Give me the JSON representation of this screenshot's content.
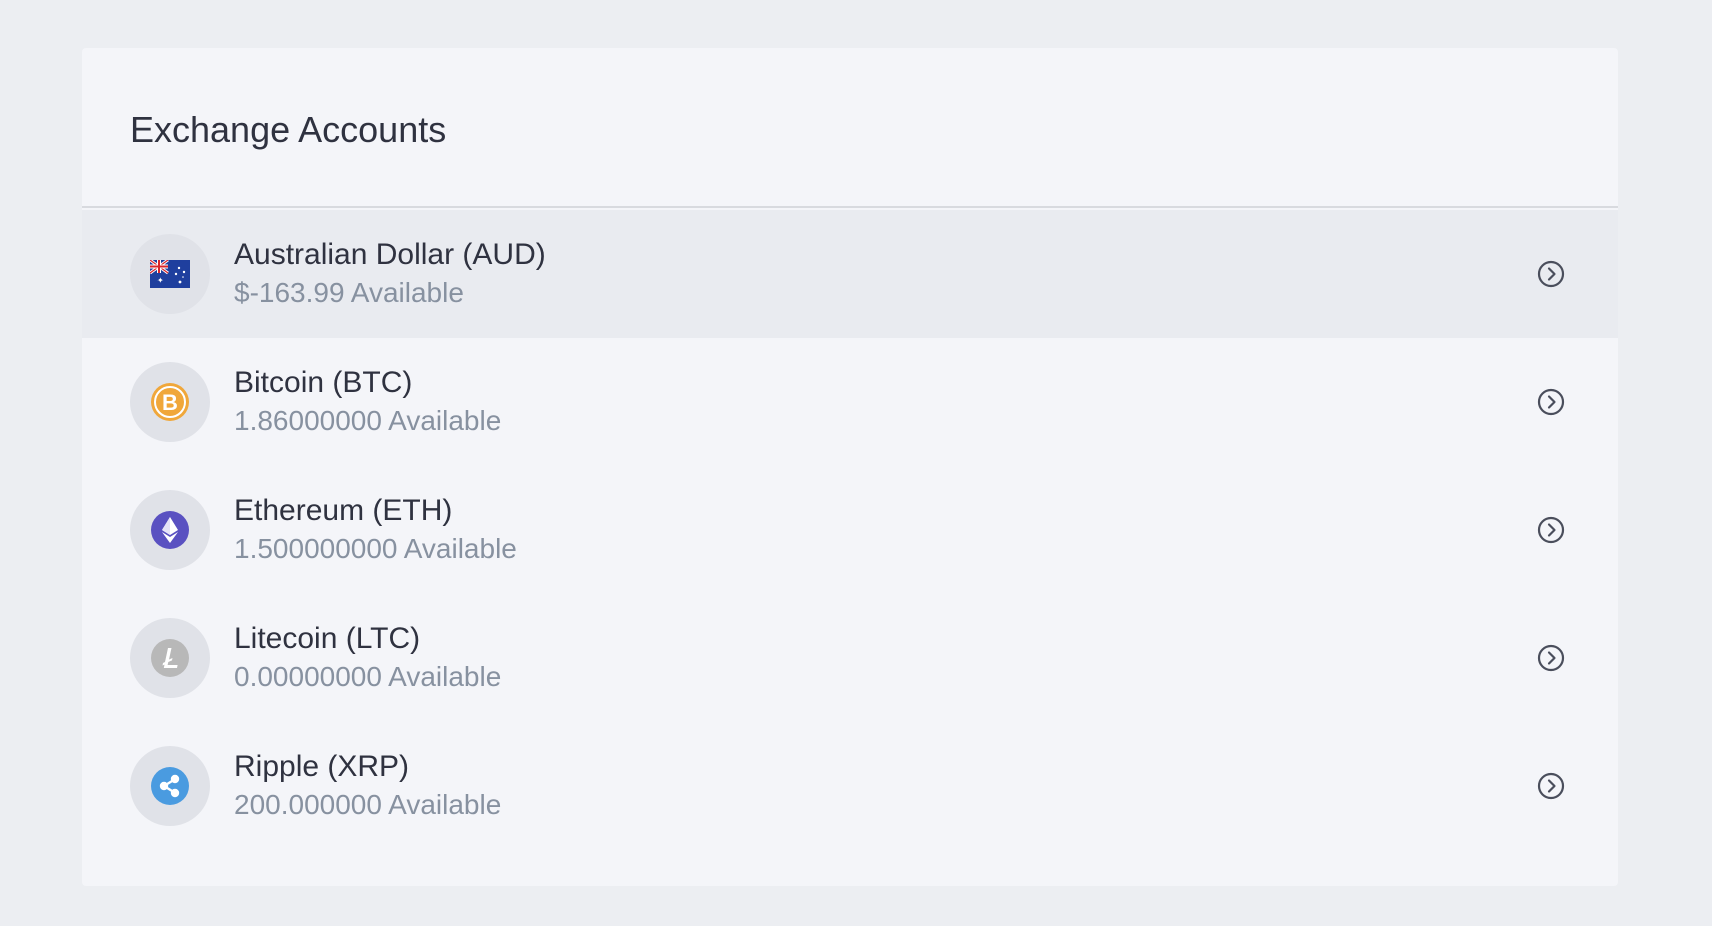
{
  "card": {
    "title": "Exchange Accounts"
  },
  "accounts": [
    {
      "name": "Australian Dollar (AUD)",
      "balance": "$-163.99 Available",
      "icon": "au-flag-icon"
    },
    {
      "name": "Bitcoin (BTC)",
      "balance": "1.86000000 Available",
      "icon": "bitcoin-icon"
    },
    {
      "name": "Ethereum (ETH)",
      "balance": "1.500000000 Available",
      "icon": "ethereum-icon"
    },
    {
      "name": "Litecoin (LTC)",
      "balance": "0.00000000 Available",
      "icon": "litecoin-icon"
    },
    {
      "name": "Ripple (XRP)",
      "balance": "200.000000 Available",
      "icon": "ripple-icon"
    }
  ],
  "colors": {
    "background": "#eceef2",
    "card": "#f4f5f9",
    "active_row": "#e9ebf0",
    "bitcoin": "#f0a73a",
    "ethereum": "#5a51c1",
    "litecoin": "#b8b8b8",
    "ripple": "#4a9be0"
  }
}
